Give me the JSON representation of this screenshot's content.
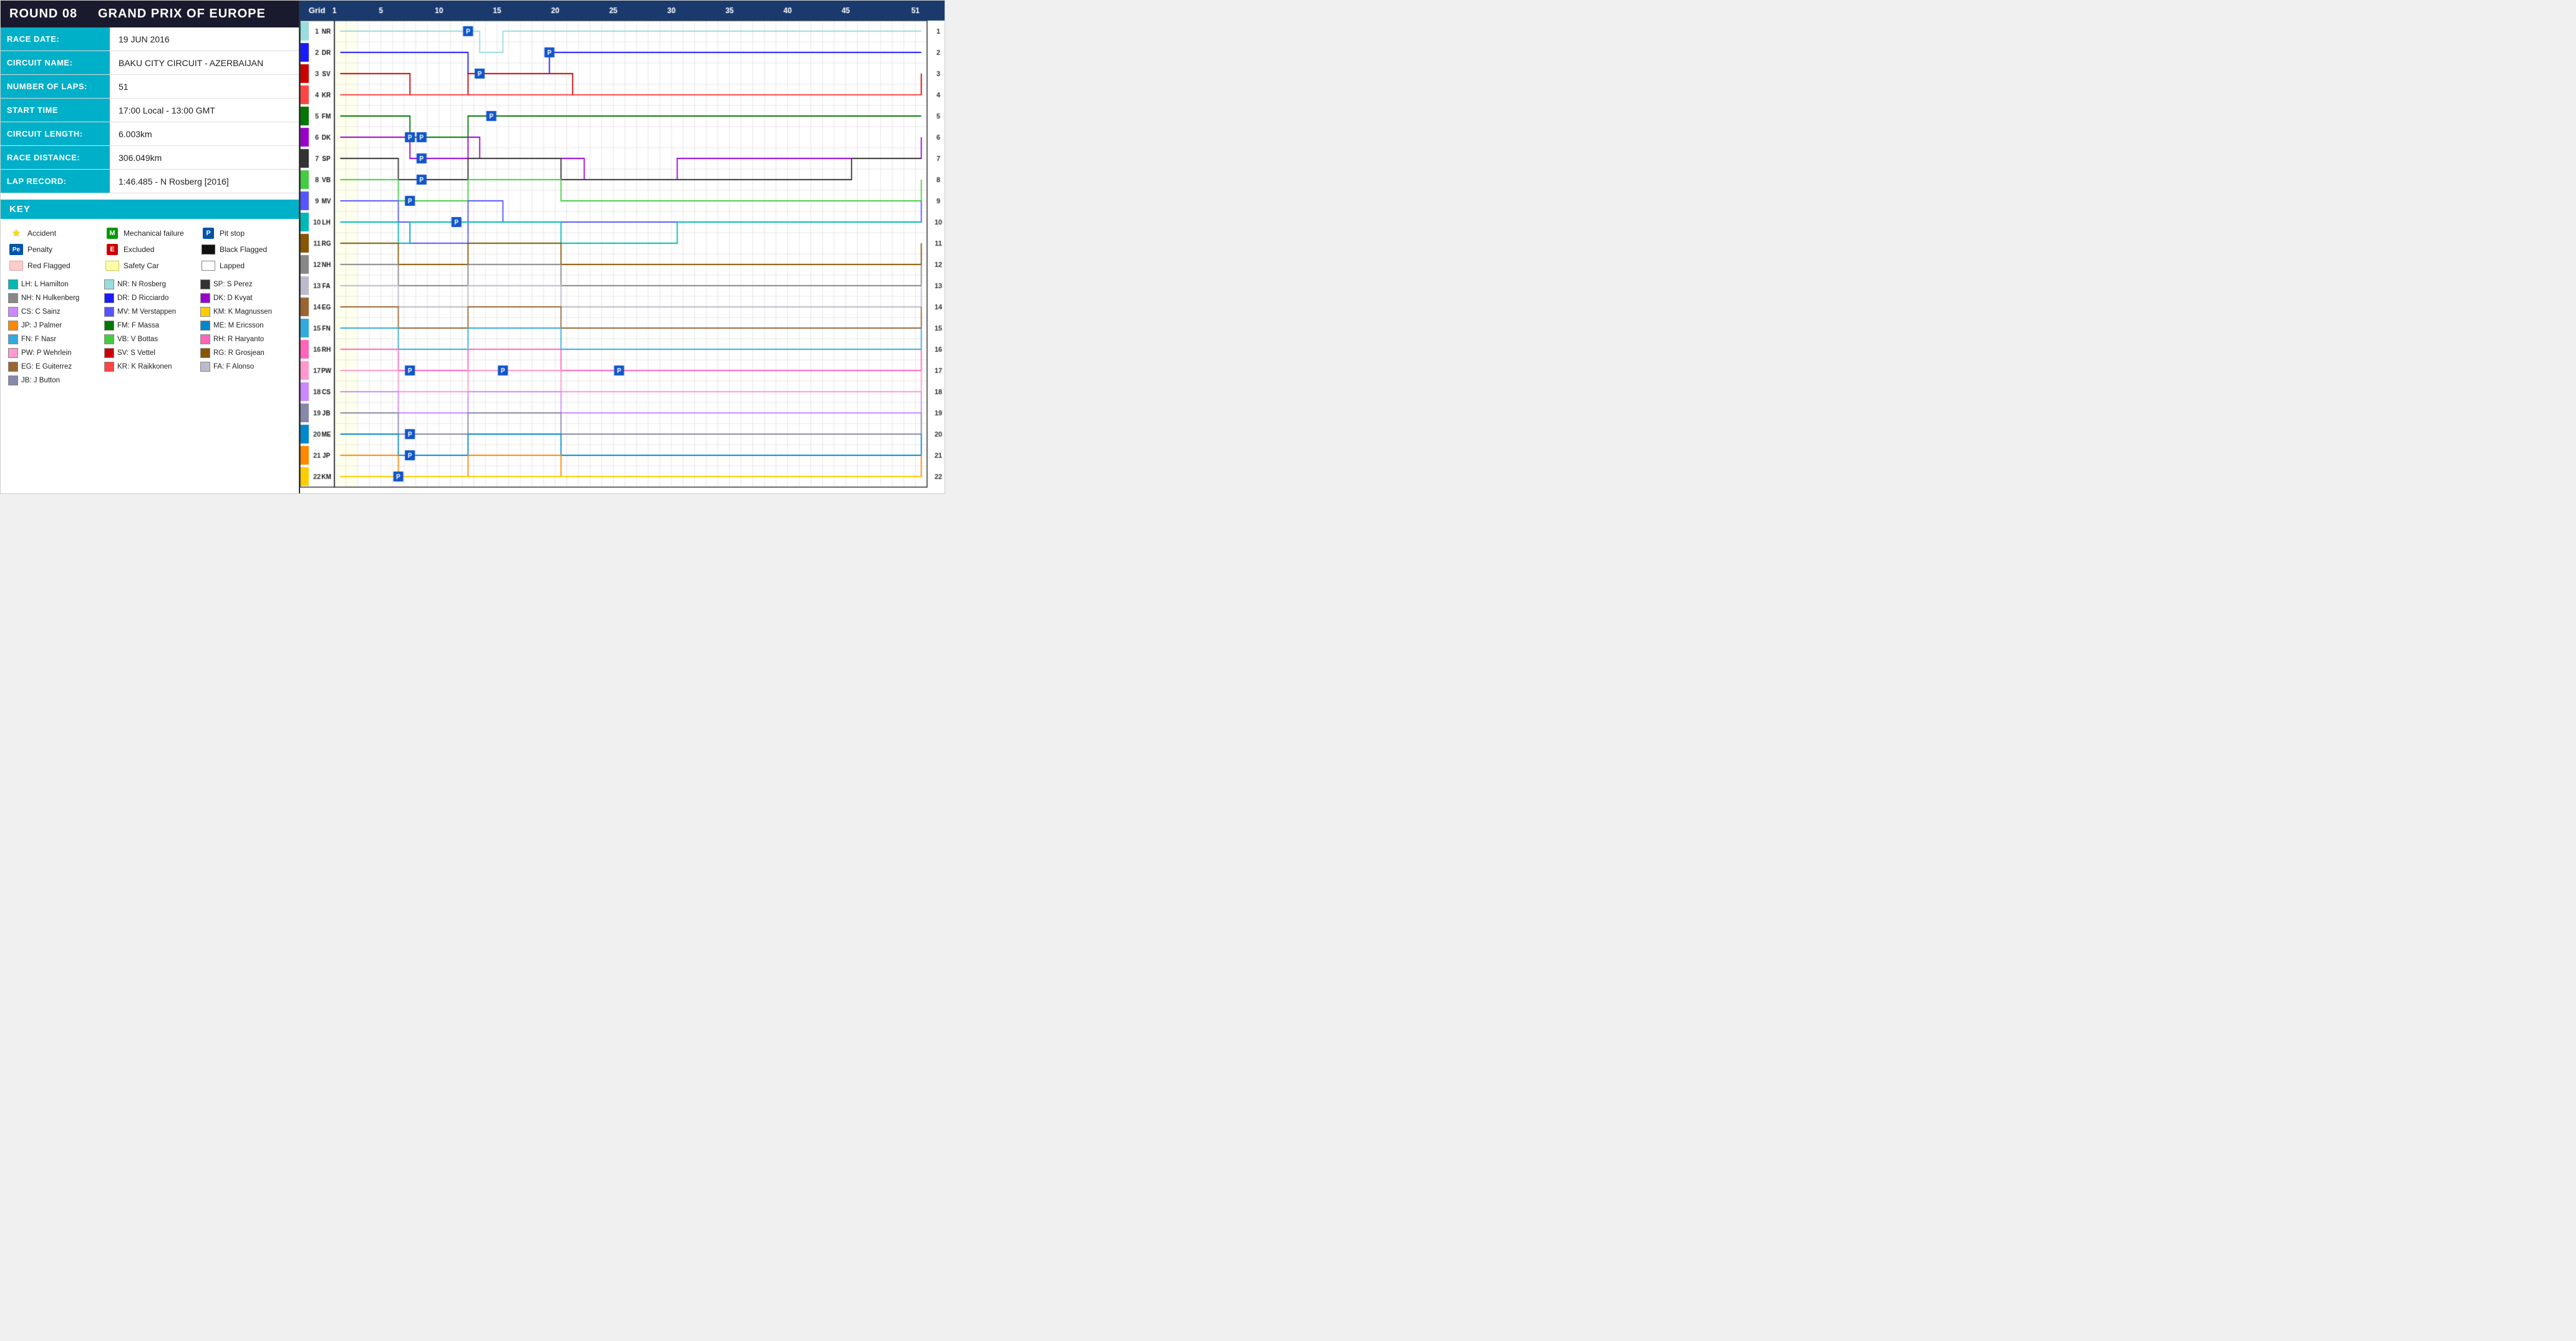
{
  "header": {
    "round": "ROUND 08",
    "race_name": "GRAND PRIX OF EUROPE"
  },
  "info": {
    "race_date_label": "RACE DATE:",
    "race_date_value": "19 JUN 2016",
    "circuit_name_label": "CIRCUIT NAME:",
    "circuit_name_value": "BAKU CITY CIRCUIT - AZERBAIJAN",
    "number_of_laps_label": "NUMBER OF LAPS:",
    "number_of_laps_value": "51",
    "start_time_label": "START TIME",
    "start_time_value": "17:00 Local - 13:00 GMT",
    "circuit_length_label": "CIRCUIT LENGTH:",
    "circuit_length_value": "6.003km",
    "race_distance_label": "RACE DISTANCE:",
    "race_distance_value": "306.049km",
    "lap_record_label": "LAP RECORD:",
    "lap_record_value": "1:46.485 - N Rosberg [2016]"
  },
  "key": {
    "header": "KEY",
    "items": [
      {
        "symbol": "star",
        "label": "Accident"
      },
      {
        "symbol": "M",
        "label": "Mechanical failure"
      },
      {
        "symbol": "P",
        "label": "Pit stop"
      },
      {
        "symbol": "Pe",
        "label": "Penalty"
      },
      {
        "symbol": "E",
        "label": "Excluded"
      },
      {
        "symbol": "black_flag",
        "label": "Black Flagged"
      },
      {
        "symbol": "red_flag",
        "label": "Red Flagged"
      },
      {
        "symbol": "safety_car",
        "label": "Safety Car"
      },
      {
        "symbol": "lapped",
        "label": "Lapped"
      }
    ]
  },
  "drivers": [
    {
      "abbr": "LH",
      "name": "L Hamilton",
      "color": "#00b8b8"
    },
    {
      "abbr": "NR",
      "name": "N Rosberg",
      "color": "#99dddd"
    },
    {
      "abbr": "DR",
      "name": "D Ricciardo",
      "color": "#1a1aff"
    },
    {
      "abbr": "MV",
      "name": "M Verstappen",
      "color": "#5555ff"
    },
    {
      "abbr": "FM",
      "name": "F Massa",
      "color": "#007700"
    },
    {
      "abbr": "VB",
      "name": "V Bottas",
      "color": "#44cc44"
    },
    {
      "abbr": "SV",
      "name": "S Vettel",
      "color": "#cc0000"
    },
    {
      "abbr": "KR",
      "name": "K Raikkonen",
      "color": "#ff4444"
    },
    {
      "abbr": "FA",
      "name": "F Alonso",
      "color": "#bbbbcc"
    },
    {
      "abbr": "JB",
      "name": "J Button",
      "color": "#8888aa"
    },
    {
      "abbr": "SP",
      "name": "S Perez",
      "color": "#333333"
    },
    {
      "abbr": "NH",
      "name": "N Hulkenberg",
      "color": "#888888"
    },
    {
      "abbr": "DK",
      "name": "D Kvyat",
      "color": "#9900cc"
    },
    {
      "abbr": "CS",
      "name": "C Sainz",
      "color": "#cc88ff"
    },
    {
      "abbr": "KM",
      "name": "K Magnussen",
      "color": "#ffcc00"
    },
    {
      "abbr": "JP",
      "name": "J Palmer",
      "color": "#ff8800"
    },
    {
      "abbr": "ME",
      "name": "M Ericsson",
      "color": "#0088cc"
    },
    {
      "abbr": "FN",
      "name": "F Nasr",
      "color": "#33aadd"
    },
    {
      "abbr": "RH",
      "name": "R Haryanto",
      "color": "#ff66bb"
    },
    {
      "abbr": "PW",
      "name": "P Wehrlein",
      "color": "#ff99cc"
    },
    {
      "abbr": "RG",
      "name": "R Grosjean",
      "color": "#885500"
    },
    {
      "abbr": "EG",
      "name": "E Guiterrez",
      "color": "#996633"
    }
  ],
  "chart": {
    "total_laps": 51,
    "grid_positions": 22,
    "lap_markers": [
      1,
      5,
      10,
      15,
      20,
      25,
      30,
      35,
      40,
      45,
      51
    ]
  }
}
